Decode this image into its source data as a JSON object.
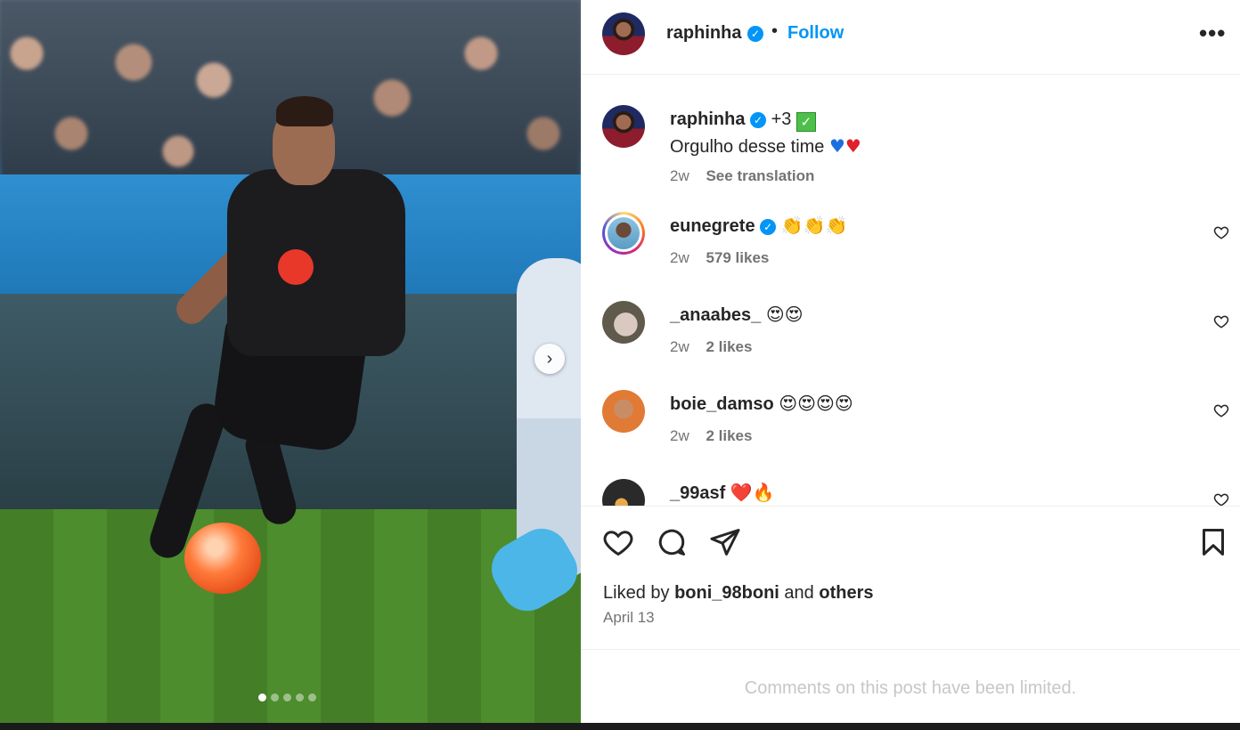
{
  "post": {
    "carousel": {
      "slide_count": 5,
      "active_index": 0,
      "next_icon": "chevron-right-icon"
    },
    "header": {
      "username": "raphinha",
      "separator": "•",
      "follow_label": "Follow",
      "more_icon": "•••"
    },
    "caption": {
      "username": "raphinha",
      "extra": "+3",
      "text": "Orgulho desse time",
      "time": "2w",
      "translate_label": "See translation"
    },
    "comments": [
      {
        "username": "eunegrete",
        "text": "👏👏👏",
        "time": "2w",
        "likes": "579 likes",
        "verified": true
      },
      {
        "username": "_anaabes_",
        "text": "😍😍",
        "time": "2w",
        "likes": "2 likes",
        "verified": false
      },
      {
        "username": "boie_damso",
        "text": "😍😍😍😍",
        "time": "2w",
        "likes": "2 likes",
        "verified": false
      },
      {
        "username": "_99asf",
        "text": "❤️🔥",
        "time": "",
        "likes": "",
        "verified": false
      }
    ],
    "liked_by": {
      "prefix": "Liked by",
      "user": "boni_98boni",
      "conj": "and",
      "others": "others"
    },
    "date": "April 13",
    "limited_notice": "Comments on this post have been limited."
  },
  "colors": {
    "accent": "#0095f6",
    "muted": "#737373",
    "heart_red": "#e0202a",
    "heart_blue": "#1c6fe0"
  }
}
